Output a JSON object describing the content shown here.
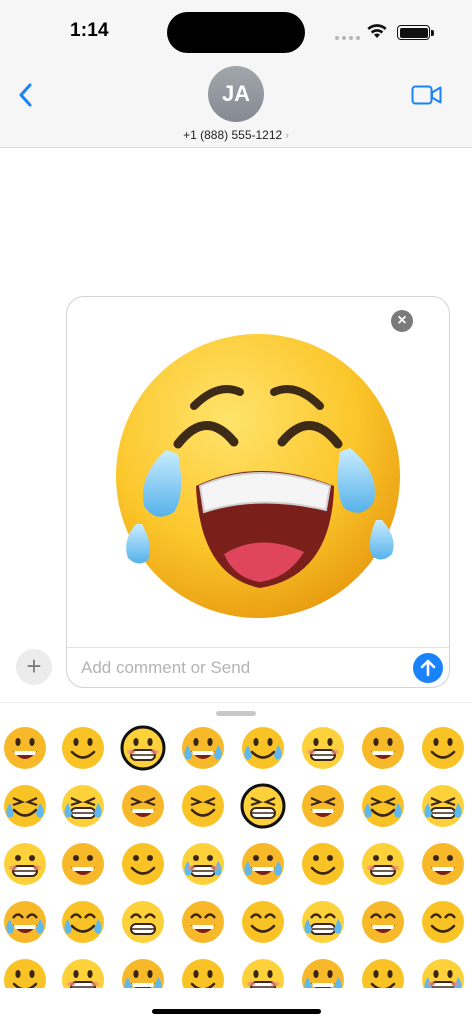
{
  "status": {
    "time": "1:14"
  },
  "header": {
    "avatar_initials": "JA",
    "contact_number": "+1 (888) 555-1212",
    "chevron": "›"
  },
  "composer": {
    "placeholder": "Add comment or Send",
    "close_glyph": "×",
    "plus_glyph": "+"
  },
  "emoji_picker": {
    "rows": 5,
    "columns": 8,
    "selected_emoji": "rolling-on-floor-laughing-with-tears"
  },
  "colors": {
    "accent": "#1a82fb",
    "emoji_yellow": "#f9c326"
  }
}
